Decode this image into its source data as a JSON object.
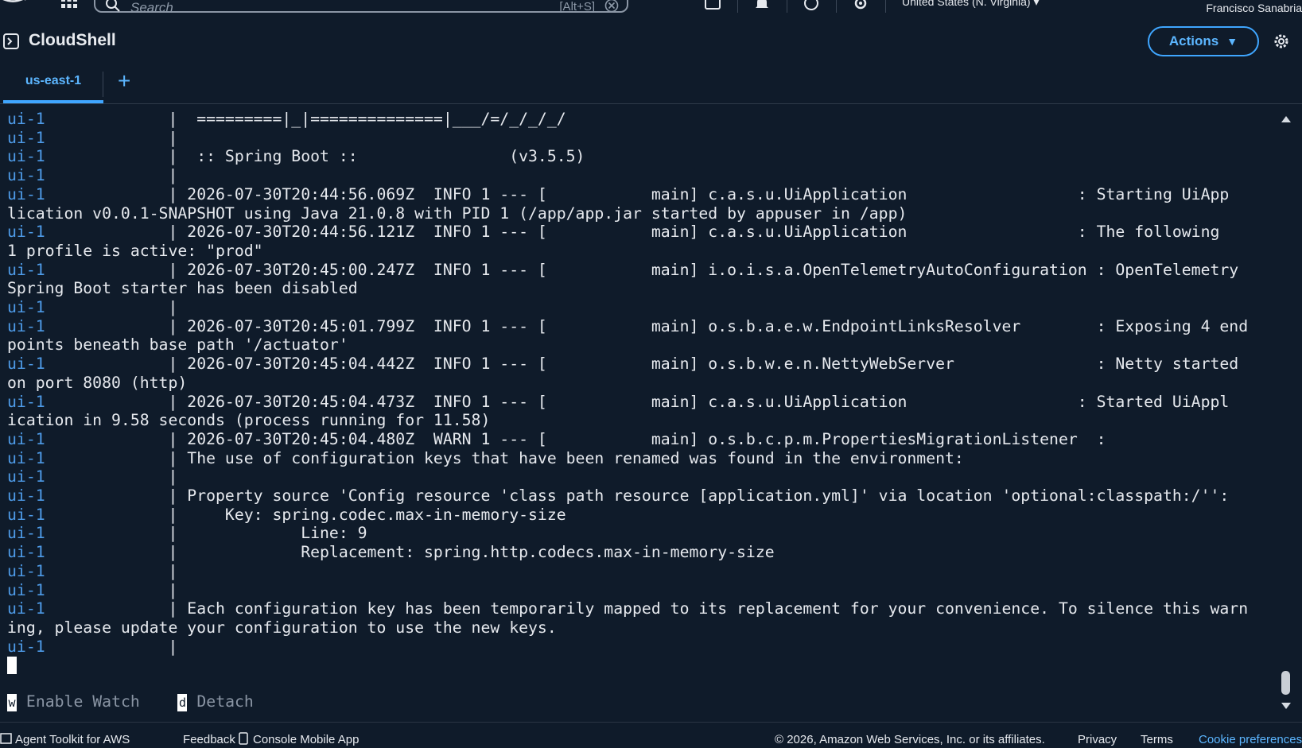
{
  "nav": {
    "search_placeholder": "Search",
    "search_shortcut": "[Alt+S]",
    "region": "United States (N. Virginia) ▾",
    "user": "Francisco Sanabria"
  },
  "header": {
    "title": "CloudShell",
    "actions_label": "Actions"
  },
  "tabs": {
    "active": "us-east-1",
    "add": "+"
  },
  "terminal": {
    "lines": [
      {
        "p": "ui-1",
        "t": "             |  =========|_|==============|___/=/_/_/_/"
      },
      {
        "p": "ui-1",
        "t": "             |"
      },
      {
        "p": "ui-1",
        "t": "             |  :: Spring Boot ::                (v3.5.5)"
      },
      {
        "p": "ui-1",
        "t": "             |"
      },
      {
        "p": "ui-1",
        "t": "             | 2026-07-30T20:44:56.069Z  INFO 1 --- [           main] c.a.s.u.UiApplication                  : Starting UiApp"
      },
      {
        "p": "",
        "t": "lication v0.0.1-SNAPSHOT using Java 21.0.8 with PID 1 (/app/app.jar started by appuser in /app)"
      },
      {
        "p": "ui-1",
        "t": "             | 2026-07-30T20:44:56.121Z  INFO 1 --- [           main] c.a.s.u.UiApplication                  : The following"
      },
      {
        "p": "",
        "t": "1 profile is active: \"prod\""
      },
      {
        "p": "ui-1",
        "t": "             | 2026-07-30T20:45:00.247Z  INFO 1 --- [           main] i.o.i.s.a.OpenTelemetryAutoConfiguration : OpenTelemetry"
      },
      {
        "p": "",
        "t": "Spring Boot starter has been disabled"
      },
      {
        "p": "ui-1",
        "t": "             |"
      },
      {
        "p": "ui-1",
        "t": "             | 2026-07-30T20:45:01.799Z  INFO 1 --- [           main] o.s.b.a.e.w.EndpointLinksResolver        : Exposing 4 end"
      },
      {
        "p": "",
        "t": "points beneath base path '/actuator'"
      },
      {
        "p": "ui-1",
        "t": "             | 2026-07-30T20:45:04.442Z  INFO 1 --- [           main] o.s.b.w.e.n.NettyWebServer               : Netty started"
      },
      {
        "p": "",
        "t": "on port 8080 (http)"
      },
      {
        "p": "ui-1",
        "t": "             | 2026-07-30T20:45:04.473Z  INFO 1 --- [           main] c.a.s.u.UiApplication                  : Started UiAppl"
      },
      {
        "p": "",
        "t": "ication in 9.58 seconds (process running for 11.58)"
      },
      {
        "p": "ui-1",
        "t": "             | 2026-07-30T20:45:04.480Z  WARN 1 --- [           main] o.s.b.c.p.m.PropertiesMigrationListener  :"
      },
      {
        "p": "ui-1",
        "t": "             | The use of configuration keys that have been renamed was found in the environment:"
      },
      {
        "p": "ui-1",
        "t": "             |"
      },
      {
        "p": "ui-1",
        "t": "             | Property source 'Config resource 'class path resource [application.yml]' via location 'optional:classpath:/'':"
      },
      {
        "p": "ui-1",
        "t": "             |     Key: spring.codec.max-in-memory-size"
      },
      {
        "p": "ui-1",
        "t": "             |             Line: 9"
      },
      {
        "p": "ui-1",
        "t": "             |             Replacement: spring.http.codecs.max-in-memory-size"
      },
      {
        "p": "ui-1",
        "t": "             |"
      },
      {
        "p": "ui-1",
        "t": "             |"
      },
      {
        "p": "ui-1",
        "t": "             | Each configuration key has been temporarily mapped to its replacement for your convenience. To silence this warn"
      },
      {
        "p": "",
        "t": "ing, please update your configuration to use the new keys."
      },
      {
        "p": "ui-1",
        "t": "             |"
      }
    ],
    "menu": {
      "watch_key": "w",
      "watch_label": " Enable Watch",
      "detach_key": "d",
      "detach_label": " Detach"
    }
  },
  "footer": {
    "agent_toolkit": "Agent Toolkit for AWS",
    "feedback": "Feedback",
    "mobile_app": "Console Mobile App",
    "copyright": "© 2026, Amazon Web Services, Inc. or its affiliates.",
    "privacy": "Privacy",
    "terms": "Terms",
    "cookie": "Cookie preferences"
  },
  "colors": {
    "background": "#0f1b2a",
    "accent": "#3fa6ff",
    "prefix": "#4e9be8"
  }
}
